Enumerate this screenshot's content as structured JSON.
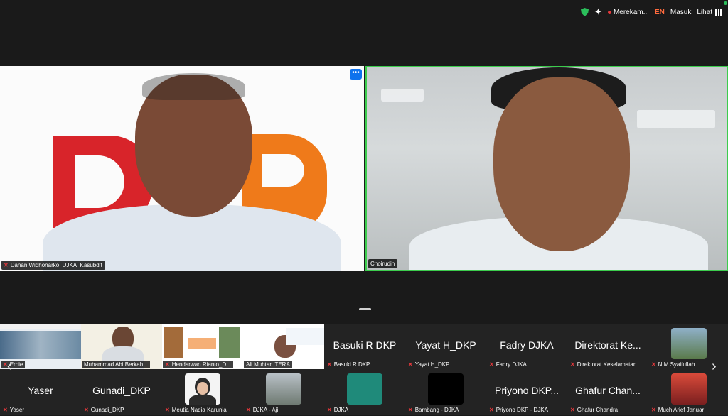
{
  "top_bar": {
    "recording": "Merekam...",
    "language": "EN",
    "signin": "Masuk",
    "view": "Lihat"
  },
  "main_tiles": {
    "left": {
      "name": "Danan Widhonarko_DJKA_Kasubdit",
      "more": "•••"
    },
    "right": {
      "name": "Choirudin"
    }
  },
  "gallery": {
    "row1": [
      {
        "label": "Ernie"
      },
      {
        "label": "Muhammad Abi Berkah..."
      },
      {
        "label": "Hendarwan Rianto_D..."
      },
      {
        "label": "Ali Muhtar ITERA"
      },
      {
        "display": "Basuki R DKP",
        "label": "Basuki R DKP"
      },
      {
        "display": "Yayat H_DKP",
        "label": "Yayat H_DKP"
      },
      {
        "display": "Fadry DJKA",
        "label": "Fadry DJKA"
      },
      {
        "display": "Direktorat Ke...",
        "label": "Direktorat Keselamatan"
      },
      {
        "label": "N M Syaifullah"
      }
    ],
    "row2": [
      {
        "display": "Yaser",
        "label": "Yaser"
      },
      {
        "display": "Gunadi_DKP",
        "label": "Gunadi_DKP"
      },
      {
        "label": "Meutia Nadia Karunia"
      },
      {
        "label": "DJKA - Aji"
      },
      {
        "label": "DJKA"
      },
      {
        "label": "Bambang - DJKA"
      },
      {
        "display": "Priyono DKP...",
        "label": "Priyono DKP - DJKA"
      },
      {
        "display": "Ghafur Chan...",
        "label": "Ghafur Chandra"
      },
      {
        "label": "Much Arief Januar"
      }
    ],
    "prev_arrow": "‹",
    "next_arrow": "›"
  },
  "colors": {
    "accent_blue": "#0e72ed",
    "active_speaker": "#3ccc4d",
    "muted_red": "#e5383b",
    "logo_red": "#d8242a",
    "logo_orange": "#ef7a1a"
  }
}
